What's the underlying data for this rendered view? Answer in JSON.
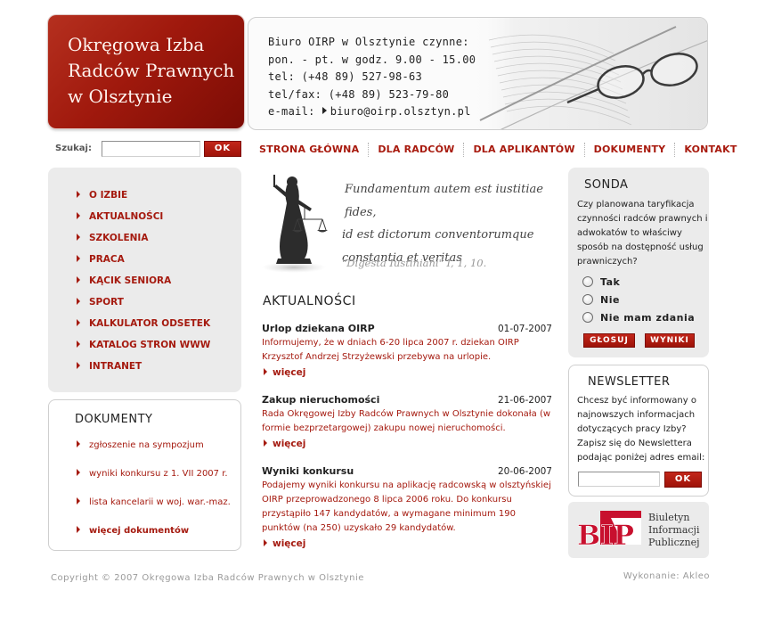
{
  "header": {
    "logo_title": "Okręgowa Izba\nRadców Prawnych\nw Olsztynie",
    "office_lines": [
      "Biuro OIRP w Olsztynie czynne:",
      "pon. - pt. w godz. 9.00 - 15.00",
      "tel: (+48 89) 527-98-63",
      "tel/fax: (+48 89) 523-79-80"
    ],
    "email_label": "e-mail:",
    "email": "biuro@oirp.olsztyn.pl"
  },
  "search": {
    "label": "Szukaj:",
    "value": "",
    "button": "OK"
  },
  "nav": {
    "items": [
      "STRONA GŁÓWNA",
      "DLA RADCÓW",
      "DLA APLIKANTÓW",
      "DOKUMENTY",
      "KONTAKT"
    ]
  },
  "sidebar": {
    "menu": [
      "O IZBIE",
      "AKTUALNOŚCI",
      "SZKOLENIA",
      "PRACA",
      "KĄCIK SENIORA",
      "SPORT",
      "KALKULATOR ODSETEK",
      "KATALOG STRON WWW",
      "INTRANET"
    ]
  },
  "documents": {
    "title": "DOKUMENTY",
    "items": [
      "zgłoszenie na sympozjum",
      "wyniki konkursu z 1. VII 2007 r.",
      "lista kancelarii w woj. war.-maz."
    ],
    "more": "więcej dokumentów"
  },
  "quote": {
    "line1": "Fundamentum autem est iustitiae fides,",
    "line2": "id est dictorum conventorumque",
    "line3": "constantia et veritas",
    "source": "\"Digesta Iustiniani\" I, 1, 10."
  },
  "news": {
    "heading": "AKTUALNOŚCI",
    "more_label": "więcej",
    "items": [
      {
        "title": "Urlop  dziekana OIRP",
        "date": "01-07-2007",
        "body": "Informujemy, że w dniach 6-20 lipca 2007 r. dziekan OIRP Krzysztof Andrzej Strzyżewski przebywa na urlopie."
      },
      {
        "title": "Zakup nieruchomości",
        "date": "21-06-2007",
        "body": "Rada Okręgowej Izby Radców Prawnych w Olsztynie dokonała (w formie bezprzetargowej) zakupu nowej nieruchomości."
      },
      {
        "title": "Wyniki konkursu",
        "date": "20-06-2007",
        "body": "Podajemy wyniki konkursu na aplikację radcowską w olsztyńskiej OIRP przeprowadzonego 8 lipca 2006 roku. Do konkursu przystąpiło 147 kandydatów, a wymagane minimum 190 punktów (na 250) uzyskało 29 kandydatów."
      }
    ]
  },
  "poll": {
    "title": "SONDA",
    "question": "Czy planowana taryfikacja czynności radców prawnych i adwokatów to właściwy sposób na dostępność usług prawniczych?",
    "options": [
      "Tak",
      "Nie",
      "Nie mam zdania"
    ],
    "vote_button": "GŁOSUJ",
    "results_button": "WYNIKI"
  },
  "newsletter": {
    "title": "NEWSLETTER",
    "text": "Chcesz być informowany o najnowszych informacjach dotyczących pracy Izby? Zapisz się do Newslettera podając poniżej adres email:",
    "value": "",
    "button": "OK"
  },
  "bip": {
    "logo_text": "BIP",
    "text": "Biuletyn Informacji Publicznej"
  },
  "footer": {
    "copyright": "Copyright © 2007 Okręgowa Izba Radców Prawnych w Olsztynie",
    "credit": "Wykonanie: Akleo"
  },
  "colors": {
    "brand_red": "#a51a0f",
    "panel_gray": "#ebebeb"
  }
}
